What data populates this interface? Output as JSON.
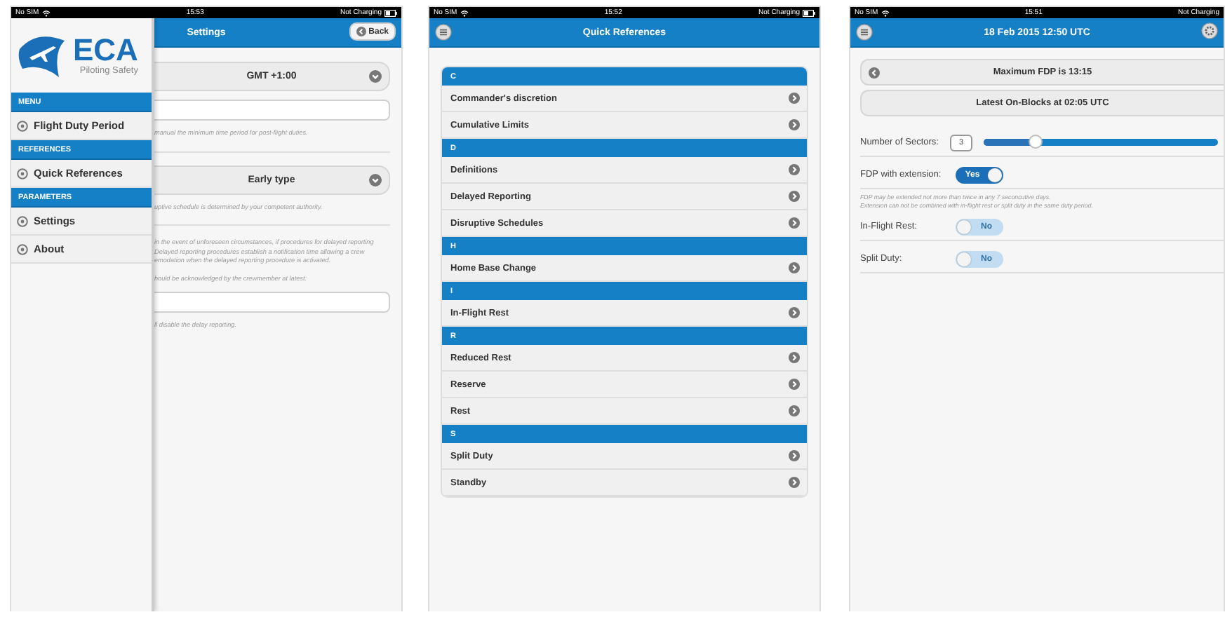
{
  "screens": [
    {
      "kind": "settings",
      "status_bar": {
        "carrier": "No SIM",
        "time": "15:53",
        "charging": "Not Charging"
      },
      "nav": {
        "title": "Settings",
        "back": "Back"
      },
      "drawer": {
        "logo": {
          "name": "ECA",
          "tagline": "Piloting Safety"
        },
        "sections": [
          {
            "header": "MENU",
            "items": [
              {
                "label": "Flight Duty Period"
              }
            ]
          },
          {
            "header": "REFERENCES",
            "items": [
              {
                "label": "Quick References"
              }
            ]
          },
          {
            "header": "PARAMETERS",
            "items": [
              {
                "label": "Settings"
              },
              {
                "label": "About"
              }
            ]
          }
        ]
      },
      "content": [
        {
          "kind": "select",
          "value": "GMT +1:00"
        },
        {
          "kind": "input"
        },
        {
          "kind": "hint",
          "lines": [
            "manual the minimum time period for post-flight duties."
          ]
        },
        {
          "kind": "divider"
        },
        {
          "kind": "select",
          "value": "Early type"
        },
        {
          "kind": "hint",
          "lines": [
            "uptive schedule is determined by your competent authority."
          ]
        },
        {
          "kind": "divider"
        },
        {
          "kind": "hint",
          "lines": [
            "in the event of unforeseen circumstances, if procedures for delayed reporting",
            "Delayed reporting procedures establish a notification time allowing a crew",
            "emodation when the delayed reporting procedure is activated."
          ]
        },
        {
          "kind": "hint",
          "lines": [
            "hould be acknowledged by the crewmember at latest:"
          ]
        },
        {
          "kind": "input"
        },
        {
          "kind": "hint",
          "lines": [
            "ll disable the delay reporting."
          ]
        }
      ]
    },
    {
      "kind": "references",
      "status_bar": {
        "carrier": "No SIM",
        "time": "15:52",
        "charging": "Not Charging"
      },
      "nav": {
        "title": "Quick References"
      },
      "sections": [
        {
          "header": "C",
          "items": [
            {
              "label": "Commander's discretion"
            },
            {
              "label": "Cumulative Limits"
            }
          ]
        },
        {
          "header": "D",
          "items": [
            {
              "label": "Definitions"
            },
            {
              "label": "Delayed Reporting"
            },
            {
              "label": "Disruptive Schedules"
            }
          ]
        },
        {
          "header": "H",
          "items": [
            {
              "label": "Home Base Change"
            }
          ]
        },
        {
          "header": "I",
          "items": [
            {
              "label": "In-Flight Rest"
            }
          ]
        },
        {
          "header": "R",
          "items": [
            {
              "label": "Reduced Rest"
            },
            {
              "label": "Reserve"
            },
            {
              "label": "Rest"
            }
          ]
        },
        {
          "header": "S",
          "items": [
            {
              "label": "Split Duty"
            },
            {
              "label": "Standby"
            }
          ]
        }
      ]
    },
    {
      "kind": "fdp",
      "status_bar": {
        "carrier": "No SIM",
        "time": "15:51",
        "charging": "Not Charging"
      },
      "nav": {
        "title": "18 Feb 2015 12:50 UTC"
      },
      "summary": [
        {
          "kind": "back",
          "text": "Maximum FDP is 13:15"
        },
        {
          "kind": "plain",
          "text": "Latest On-Blocks at 02:05 UTC"
        }
      ],
      "controls": [
        {
          "kind": "slider",
          "label": "Number of Sectors:",
          "value": "3",
          "level": 0.22
        },
        {
          "kind": "toggle",
          "label": "FDP with extension:",
          "state_text": "Yes",
          "on": true
        },
        {
          "kind": "note",
          "lines": [
            "FDP may be extended not more than twice in any 7 seconcutive days.",
            "Extension can not be combined with in-flight rest or split duty in the same duty period."
          ]
        },
        {
          "kind": "toggle",
          "label": "In-Flight Rest:",
          "state_text": "No",
          "on": false
        },
        {
          "kind": "toggle",
          "label": "Split Duty:",
          "state_text": "No",
          "on": false
        }
      ]
    }
  ]
}
